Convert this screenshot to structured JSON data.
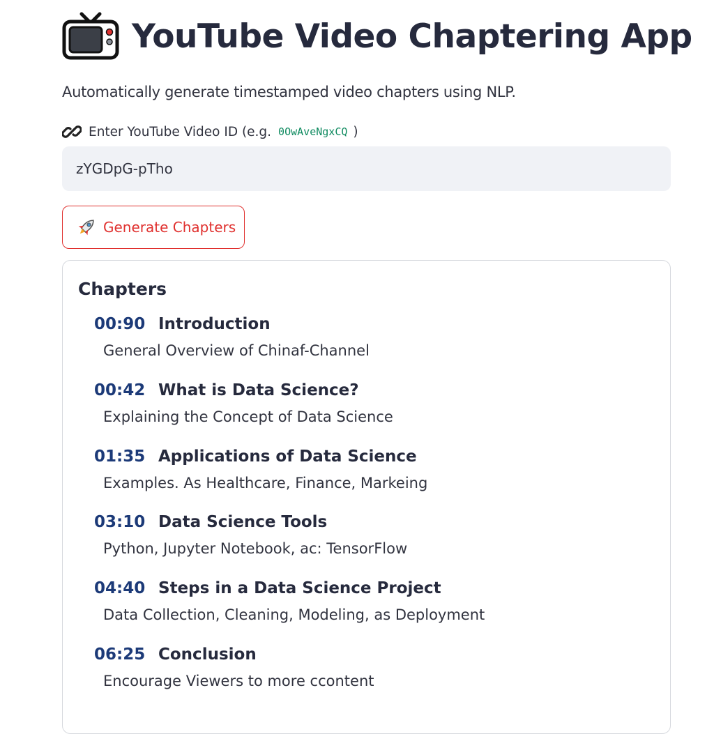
{
  "app": {
    "title": "YouTube Video Chaptering App",
    "subtitle": "Automatically generate timestamped video chapters using NLP."
  },
  "input": {
    "label_prefix": "Enter YouTube Video ID (e.g.",
    "example_id": "0OwAveNgxCQ",
    "label_suffix": ")",
    "value": "zYGDpG-pTho"
  },
  "button": {
    "label": "Generate Chapters"
  },
  "chapters": {
    "heading": "Chapters",
    "items": [
      {
        "time": "00:90",
        "title": "Introduction",
        "description": "General Overview of Chinaf-Channel"
      },
      {
        "time": "00:42",
        "title": "What is Data Science?",
        "description": "Explaining the Concept of Data Science"
      },
      {
        "time": "01:35",
        "title": "Applications of Data Science",
        "description": "Examples. As Healthcare, Finance, Markeing"
      },
      {
        "time": "03:10",
        "title": "Data Science Tools",
        "description": "Python, Jupyter Notebook, ac: TensorFlow"
      },
      {
        "time": "04:40",
        "title": "Steps in a Data Science Project",
        "description": "Data Collection, Cleaning, Modeling, as Deployment"
      },
      {
        "time": "06:25",
        "title": "Conclusion",
        "description": "Encourage Viewers to more ccontent"
      }
    ]
  },
  "icons": {
    "title": "tv-icon",
    "input": "link-icon",
    "button": "rocket-icon"
  },
  "colors": {
    "accent": "#e0312f",
    "timestamp": "#1c3a78",
    "code": "#0e8a5f",
    "input_bg": "#f0f2f6"
  }
}
